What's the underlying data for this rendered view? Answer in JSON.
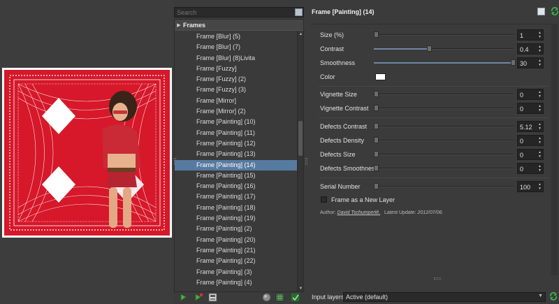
{
  "search": {
    "placeholder": "Search"
  },
  "filter_list": {
    "category": "Frames",
    "items": [
      "Frame [Blur] (5)",
      "Frame [Blur] (7)",
      "Frame [Blur] (8)Livita",
      "Frame [Fuzzy]",
      "Frame [Fuzzy] (2)",
      "Frame [Fuzzy] (3)",
      "Frame [Mirror]",
      "Frame [Mirror] (2)",
      "Frame [Painting] (10)",
      "Frame [Painting] (11)",
      "Frame [Painting] (12)",
      "Frame [Painting] (13)",
      "Frame [Painting] (14)",
      "Frame [Painting] (15)",
      "Frame [Painting] (16)",
      "Frame [Painting] (17)",
      "Frame [Painting] (18)",
      "Frame [Painting] (19)",
      "Frame [Painting] (2)",
      "Frame [Painting] (20)",
      "Frame [Painting] (21)",
      "Frame [Painting] (22)",
      "Frame [Painting] (3)",
      "Frame [Painting] (4)"
    ],
    "selected_index": 12
  },
  "params": {
    "title": "Frame [Painting] (14)",
    "size_label": "Size (%)",
    "size_value": "1",
    "size_frac": 0.0,
    "contrast_label": "Contrast",
    "contrast_value": "0.4",
    "contrast_frac": 0.4,
    "smoothness_label": "Smoothness",
    "smoothness_value": "30",
    "smoothness_frac": 1.0,
    "color_label": "Color",
    "color_value": "#ffffff",
    "vignette_size_label": "Vignette Size",
    "vignette_size_value": "0",
    "vignette_size_frac": 0.0,
    "vignette_contrast_label": "Vignette Contrast",
    "vignette_contrast_value": "0",
    "vignette_contrast_frac": 0.0,
    "defects_contrast_label": "Defects Contrast",
    "defects_contrast_value": "5.12",
    "defects_contrast_frac": 0.0,
    "defects_density_label": "Defects Density",
    "defects_density_value": "0",
    "defects_density_frac": 0.0,
    "defects_size_label": "Defects Size",
    "defects_size_value": "0",
    "defects_size_frac": 0.0,
    "defects_smoothness_label": "Defects Smoothness",
    "defects_smoothness_value": "0",
    "defects_smoothness_frac": 0.0,
    "serial_number_label": "Serial Number",
    "serial_number_value": "100",
    "serial_number_frac": 0.0,
    "new_layer_label": "Frame as a New Layer",
    "new_layer_checked": false,
    "author_label": "Author:",
    "author_name": "David Tschumperlé.",
    "update_label": "Latest Update:",
    "update_date": "2012/07/06."
  },
  "input_layers": {
    "label": "Input layers",
    "value": "Active (default)"
  },
  "colors": {
    "accent": "#577aa0",
    "preview_red": "#d6182a",
    "refresh_green": "#3aa84a"
  }
}
